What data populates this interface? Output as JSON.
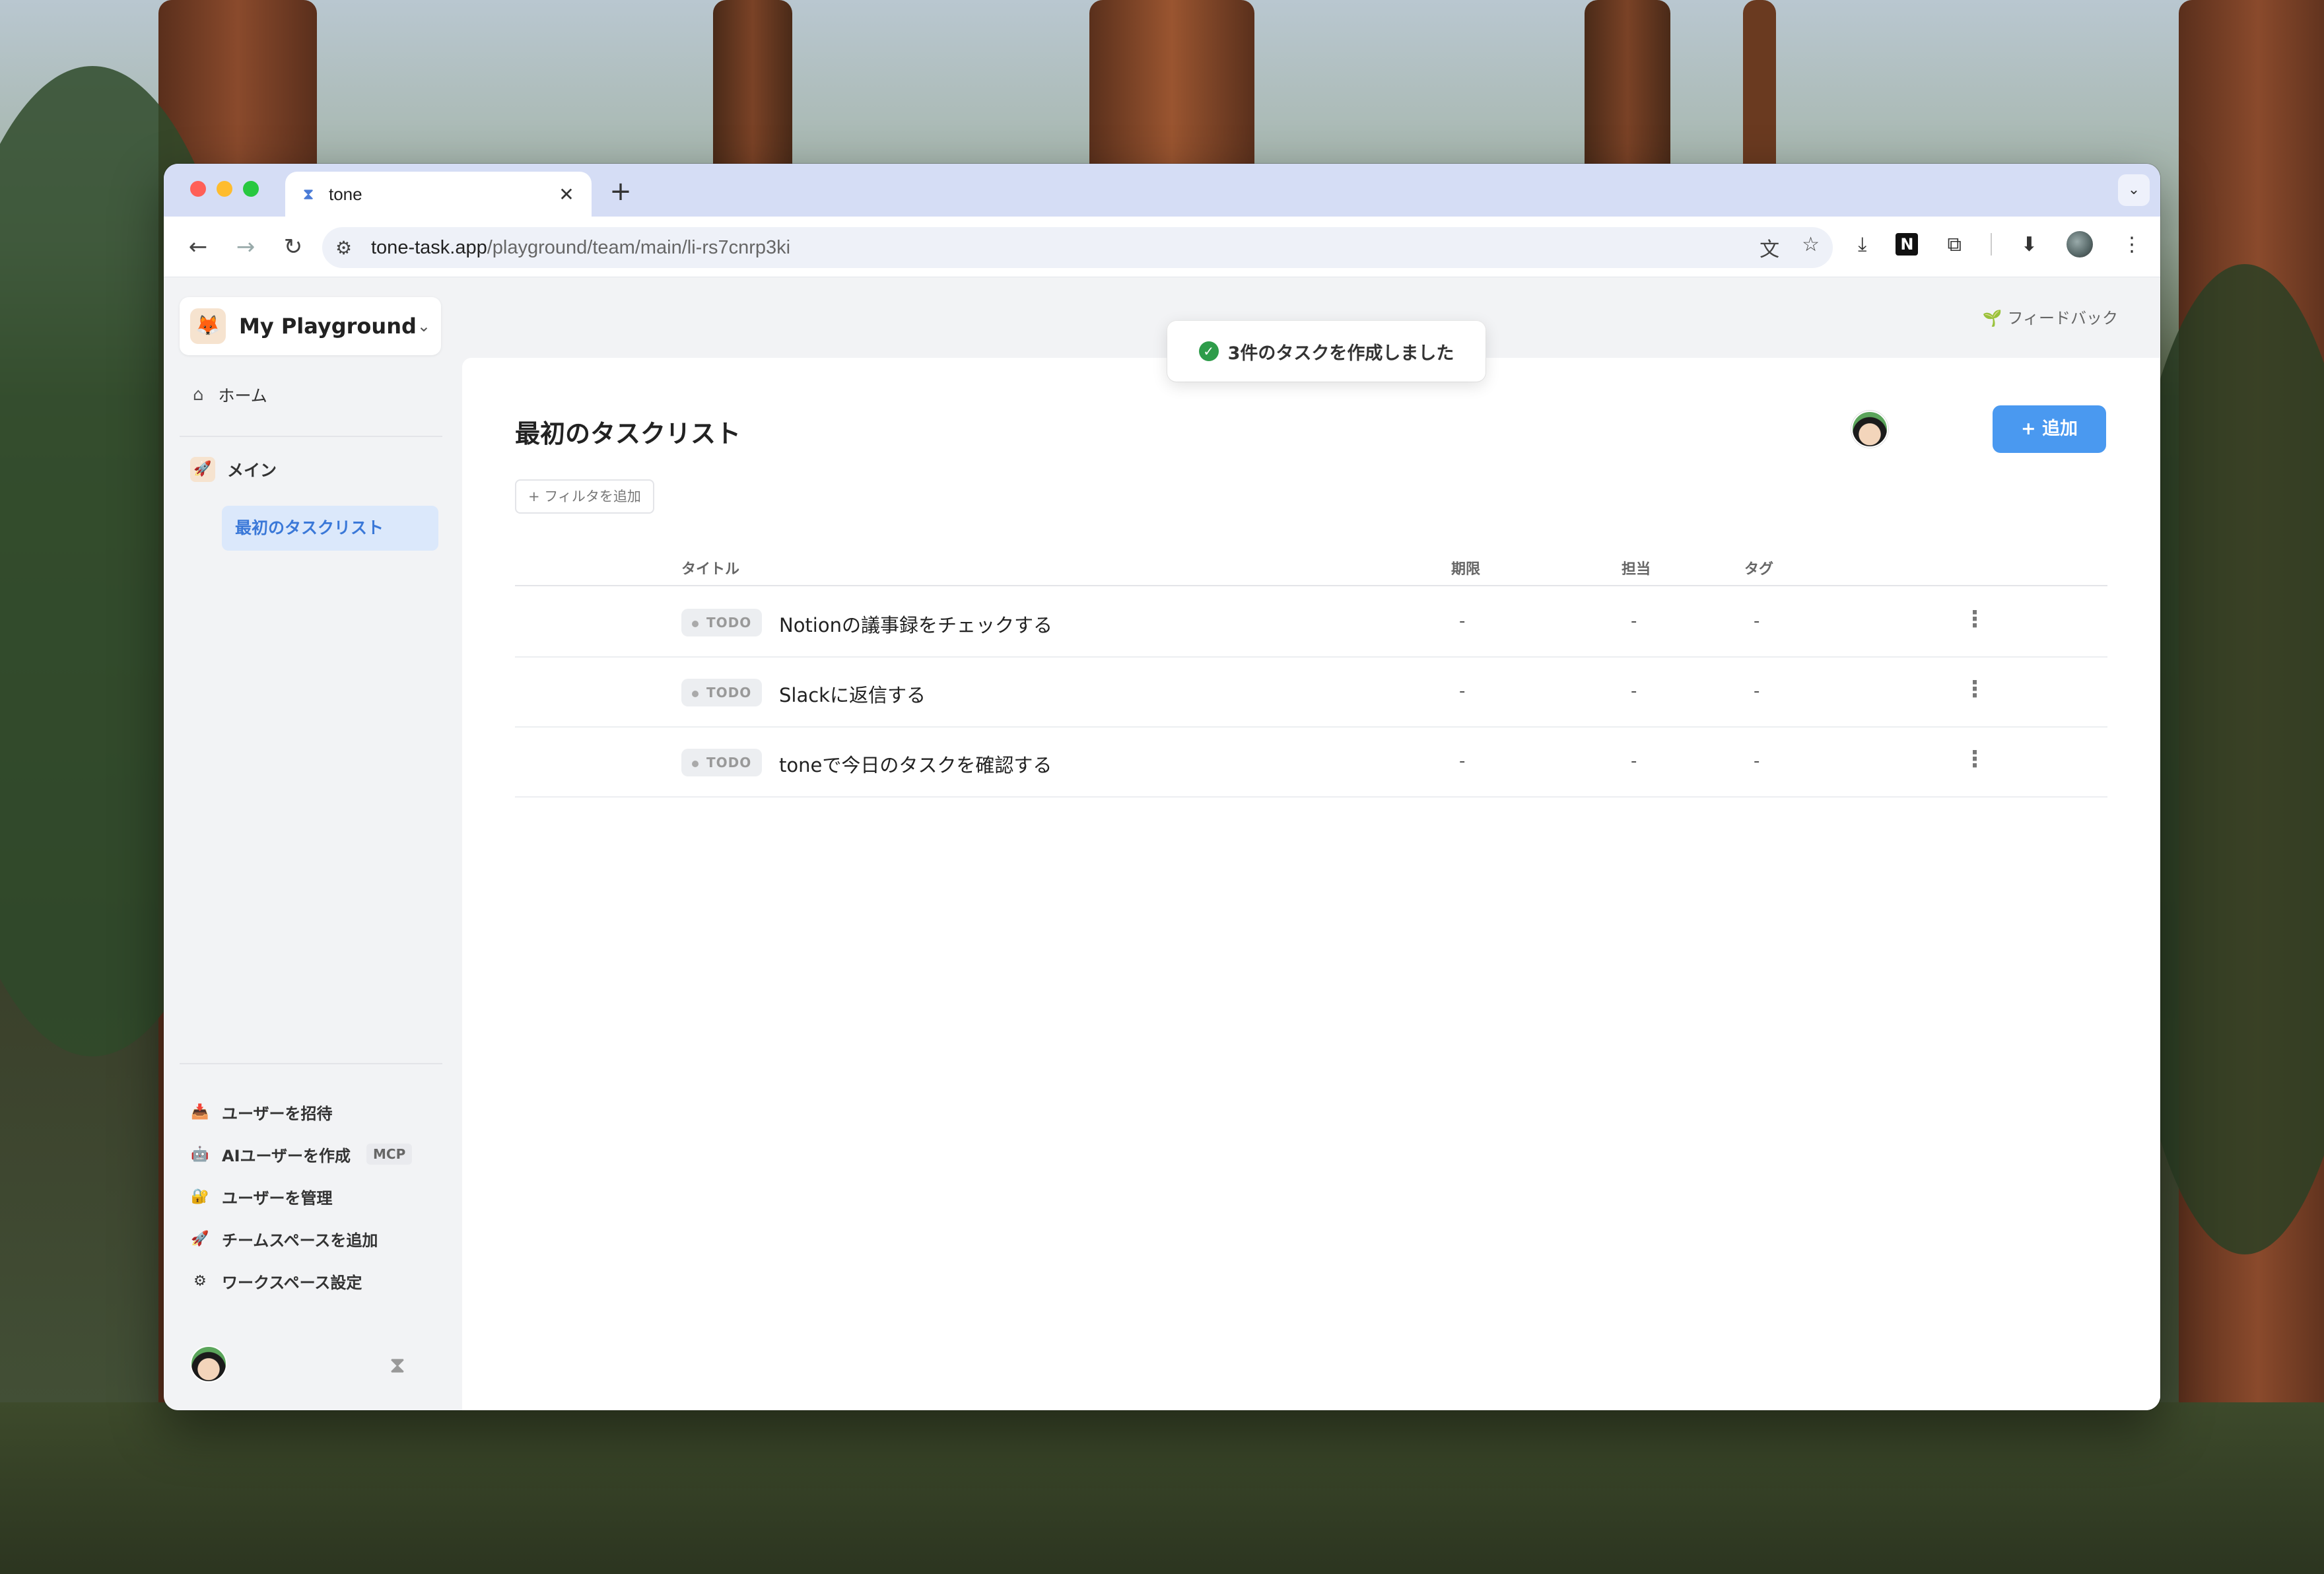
{
  "browser": {
    "tab_title": "tone",
    "tab_close": "✕",
    "new_tab": "+",
    "url_host": "tone-task.app",
    "url_path": "/playground/team/main/li-rs7cnrp3ki"
  },
  "workspace": {
    "name": "My Playground"
  },
  "sidebar": {
    "home": "ホーム",
    "main_section": "メイン",
    "active_list": "最初のタスクリスト",
    "bottom_items": [
      {
        "label": "ユーザーを招待",
        "icon": "📥"
      },
      {
        "label": "AIユーザーを作成",
        "icon": "🤖",
        "badge": "MCP"
      },
      {
        "label": "ユーザーを管理",
        "icon": "🔐"
      },
      {
        "label": "チームスペースを追加",
        "icon": "🚀"
      },
      {
        "label": "ワークスペース設定",
        "icon": "⚙"
      }
    ]
  },
  "header": {
    "feedback": "フィードバック"
  },
  "toast": {
    "message": "3件のタスクを作成しました"
  },
  "page": {
    "title": "最初のタスクリスト",
    "add_button": "+ 追加",
    "filter_button": "+ フィルタを追加"
  },
  "table": {
    "columns": [
      "タイトル",
      "期限",
      "担当",
      "タグ"
    ],
    "rows": [
      {
        "status": "TODO",
        "title": "Notionの議事録をチェックする",
        "due": "-",
        "assignee": "-",
        "tag": "-"
      },
      {
        "status": "TODO",
        "title": "Slackに返信する",
        "due": "-",
        "assignee": "-",
        "tag": "-"
      },
      {
        "status": "TODO",
        "title": "toneで今日のタスクを確認する",
        "due": "-",
        "assignee": "-",
        "tag": "-"
      }
    ]
  },
  "colors": {
    "accent": "#4a99f0",
    "active_bg": "#dbe8fb",
    "active_text": "#3a78d8",
    "success": "#2e9c4a"
  }
}
